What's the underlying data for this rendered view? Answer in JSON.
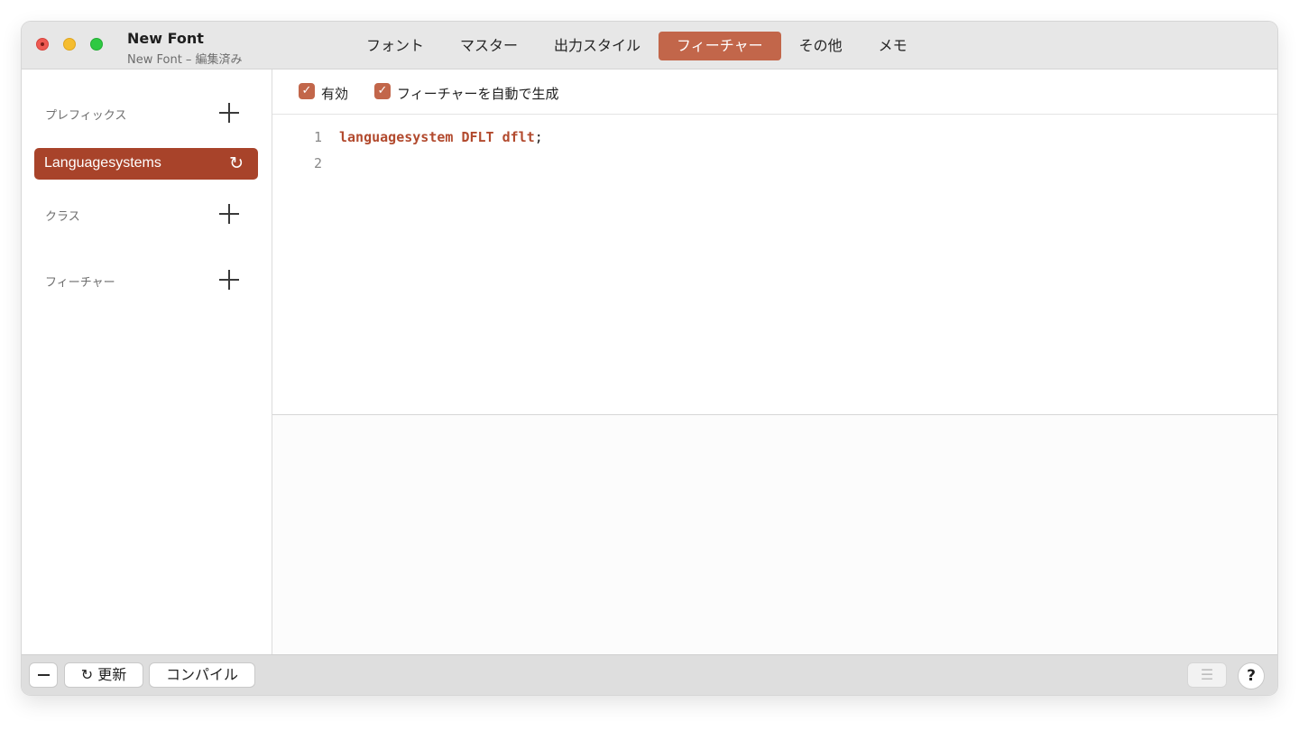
{
  "window": {
    "title": "New Font",
    "subtitle": "New Font – 編集済み"
  },
  "tabs": [
    {
      "label": "フォント",
      "active": false
    },
    {
      "label": "マスター",
      "active": false
    },
    {
      "label": "出力スタイル",
      "active": false
    },
    {
      "label": "フィーチャー",
      "active": true
    },
    {
      "label": "その他",
      "active": false
    },
    {
      "label": "メモ",
      "active": false
    }
  ],
  "sidebar": {
    "prefix_header": "プレフィックス",
    "prefix_items": [
      {
        "label": "Languagesystems",
        "selected": true,
        "icon": "refresh-icon"
      }
    ],
    "classes_header": "クラス",
    "features_header": "フィーチャー"
  },
  "editor": {
    "enabled_label": "有効",
    "enabled_checked": true,
    "autogen_label": "フィーチャーを自動で生成",
    "autogen_checked": true,
    "lines": [
      {
        "number": "1",
        "code": "languagesystem DFLT dflt",
        "terminator": ";"
      },
      {
        "number": "2",
        "code": "",
        "terminator": ""
      }
    ]
  },
  "bottombar": {
    "update_label": "更新",
    "compile_label": "コンパイル",
    "help_label": "?"
  },
  "colors": {
    "accent": "#c2664a",
    "selected": "#a8432a",
    "code_keyword": "#b24a2e"
  }
}
